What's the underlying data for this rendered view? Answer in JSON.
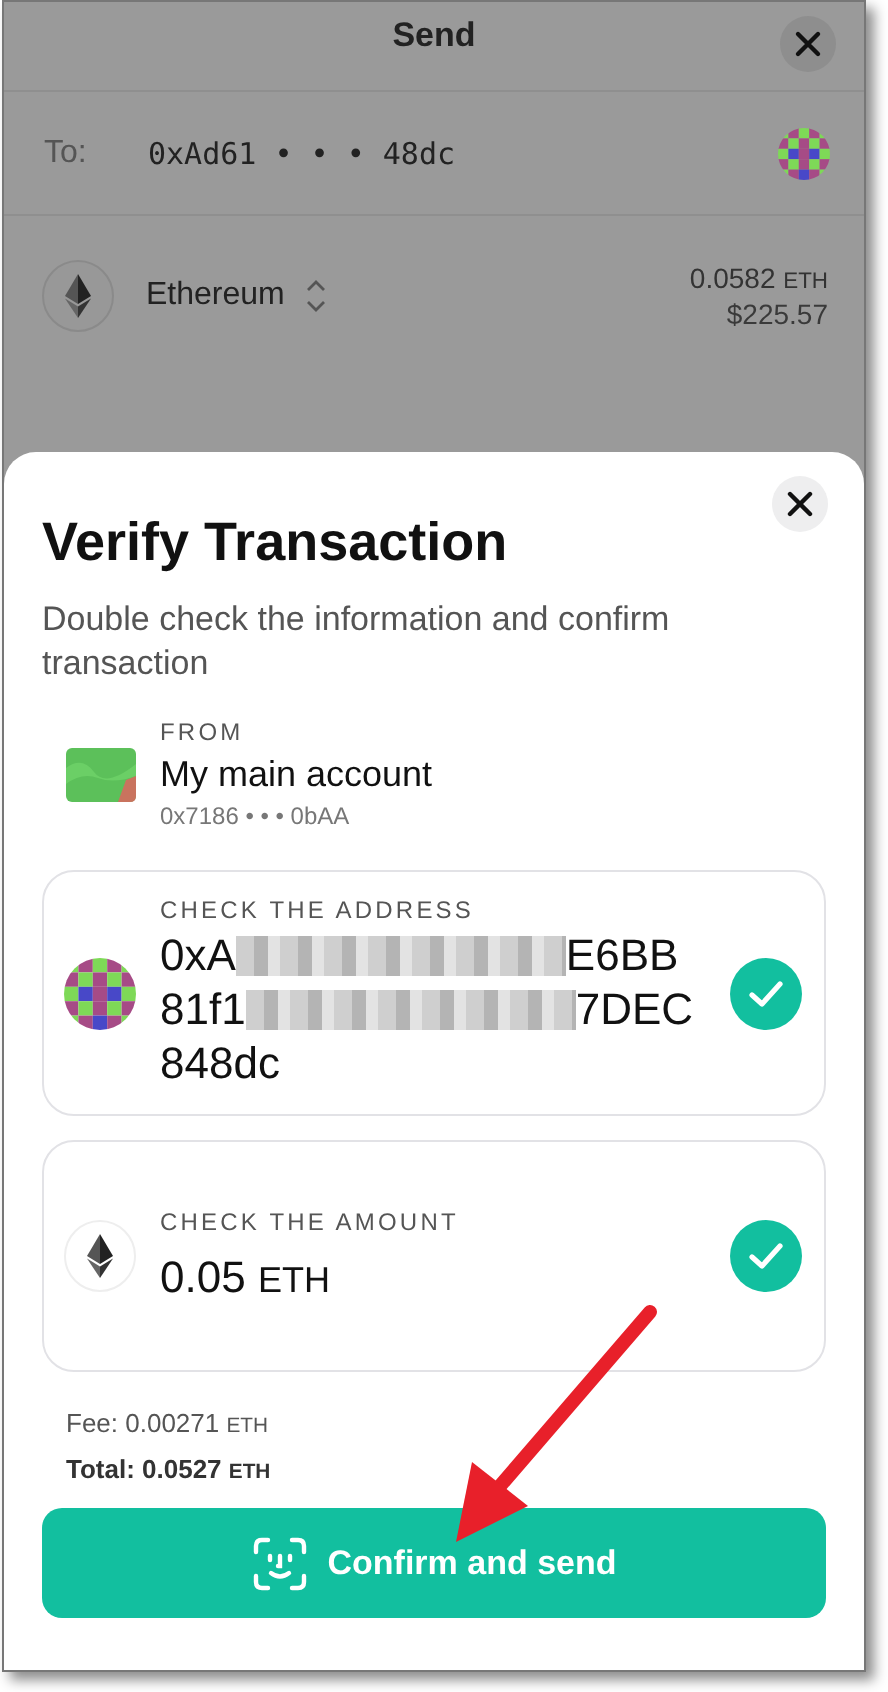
{
  "send_screen": {
    "title": "Send",
    "to_label": "To:",
    "to_address": "0xAd61 • • • 48dc",
    "asset": {
      "name": "Ethereum",
      "balance": "0.0582",
      "balance_unit": "ETH",
      "fiat": "$225.57"
    }
  },
  "verify_sheet": {
    "title": "Verify Transaction",
    "subtitle": "Double check the information and confirm transaction",
    "from": {
      "label": "FROM",
      "name": "My main account",
      "address": "0x7186 • • • 0bAA"
    },
    "checks": [
      {
        "kind": "address",
        "label": "CHECK THE ADDRESS",
        "verified": true,
        "lines": [
          {
            "start": "0xA",
            "redacted": true,
            "end": "E6BB"
          },
          {
            "start": "81f1",
            "redacted": true,
            "end": "7DEC"
          },
          {
            "start": "848dc",
            "redacted": false
          }
        ]
      },
      {
        "kind": "amount",
        "label": "CHECK THE AMOUNT",
        "verified": true,
        "amount": "0.05",
        "unit": "ETH"
      }
    ],
    "fee": {
      "label": "Fee:",
      "amount": "0.00271",
      "unit": "ETH"
    },
    "total": {
      "label": "Total:",
      "amount": "0.0527",
      "unit": "ETH"
    },
    "confirm_button": "Confirm and send"
  }
}
